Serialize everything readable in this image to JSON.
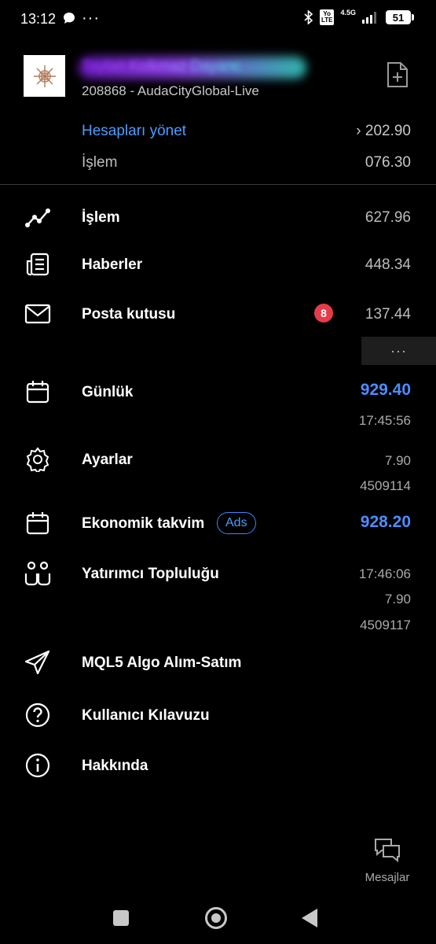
{
  "status_bar": {
    "time": "13:12",
    "volte": "Yo LTE",
    "network": "4.5G",
    "battery": "51"
  },
  "account": {
    "name": "Taylan Kolkmaz Dayanc",
    "number_server": "208868 - AudaCityGlobal-Live"
  },
  "header_rows": {
    "manage_label": "Hesapları yönet",
    "manage_value": "› 202.90",
    "trade_label": "İşlem",
    "trade_value": "076.30"
  },
  "menu": {
    "trade": {
      "label": "İşlem",
      "value": "627.96"
    },
    "news": {
      "label": "Haberler",
      "value": "448.34"
    },
    "mailbox": {
      "label": "Posta kutusu",
      "badge": "8",
      "value": "137.44"
    },
    "more": "···",
    "journal": {
      "label": "Günlük",
      "value": "929.40",
      "time": "17:45:56"
    },
    "settings": {
      "label": "Ayarlar",
      "value": "7.90",
      "code": "4509114"
    },
    "calendar": {
      "label": "Ekonomik takvim",
      "ads": "Ads",
      "value": "928.20"
    },
    "community": {
      "label": "Yatırımcı Topluluğu",
      "time": "17:46:06",
      "value": "7.90",
      "code": "4509117"
    },
    "algo": {
      "label": "MQL5 Algo Alım-Satım"
    },
    "guide": {
      "label": "Kullanıcı Kılavuzu"
    },
    "about": {
      "label": "Hakkında"
    }
  },
  "messages": {
    "label": "Mesajlar"
  },
  "colors": {
    "accent_blue": "#4d8cff",
    "badge_red": "#e53c4a",
    "background": "#000000"
  }
}
